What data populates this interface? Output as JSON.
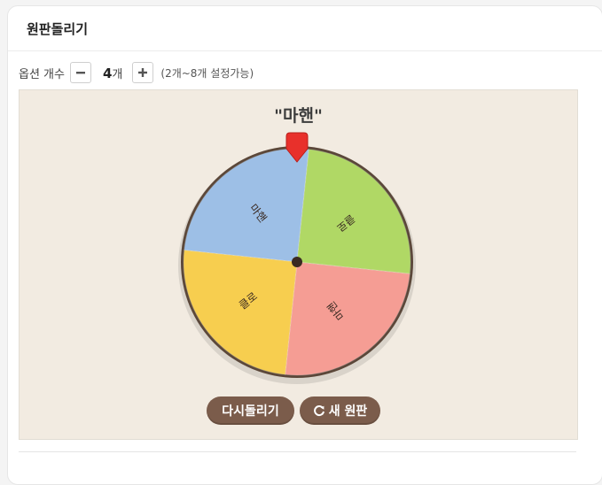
{
  "header": {
    "title": "원판돌리기"
  },
  "options": {
    "label": "옵션 개수",
    "minus_icon": "minus-icon",
    "count": "4",
    "unit": "개",
    "plus_icon": "plus-icon",
    "hint": "(2개~8개 설정가능)"
  },
  "result": {
    "text": "\"마핸\""
  },
  "wheel": {
    "segments": [
      {
        "label": "마핸",
        "color": "#9dbfe6"
      },
      {
        "label": "클로",
        "color": "#b0d865"
      },
      {
        "label": "마핸",
        "color": "#f59d94"
      },
      {
        "label": "클로",
        "color": "#f7ce4f"
      }
    ],
    "rim_color": "#5b4739",
    "pointer_color": "#e8302b",
    "hub_color": "#3a2a22"
  },
  "buttons": {
    "spin_label": "다시돌리기",
    "new_label": "새 원판",
    "new_icon": "refresh-icon"
  }
}
